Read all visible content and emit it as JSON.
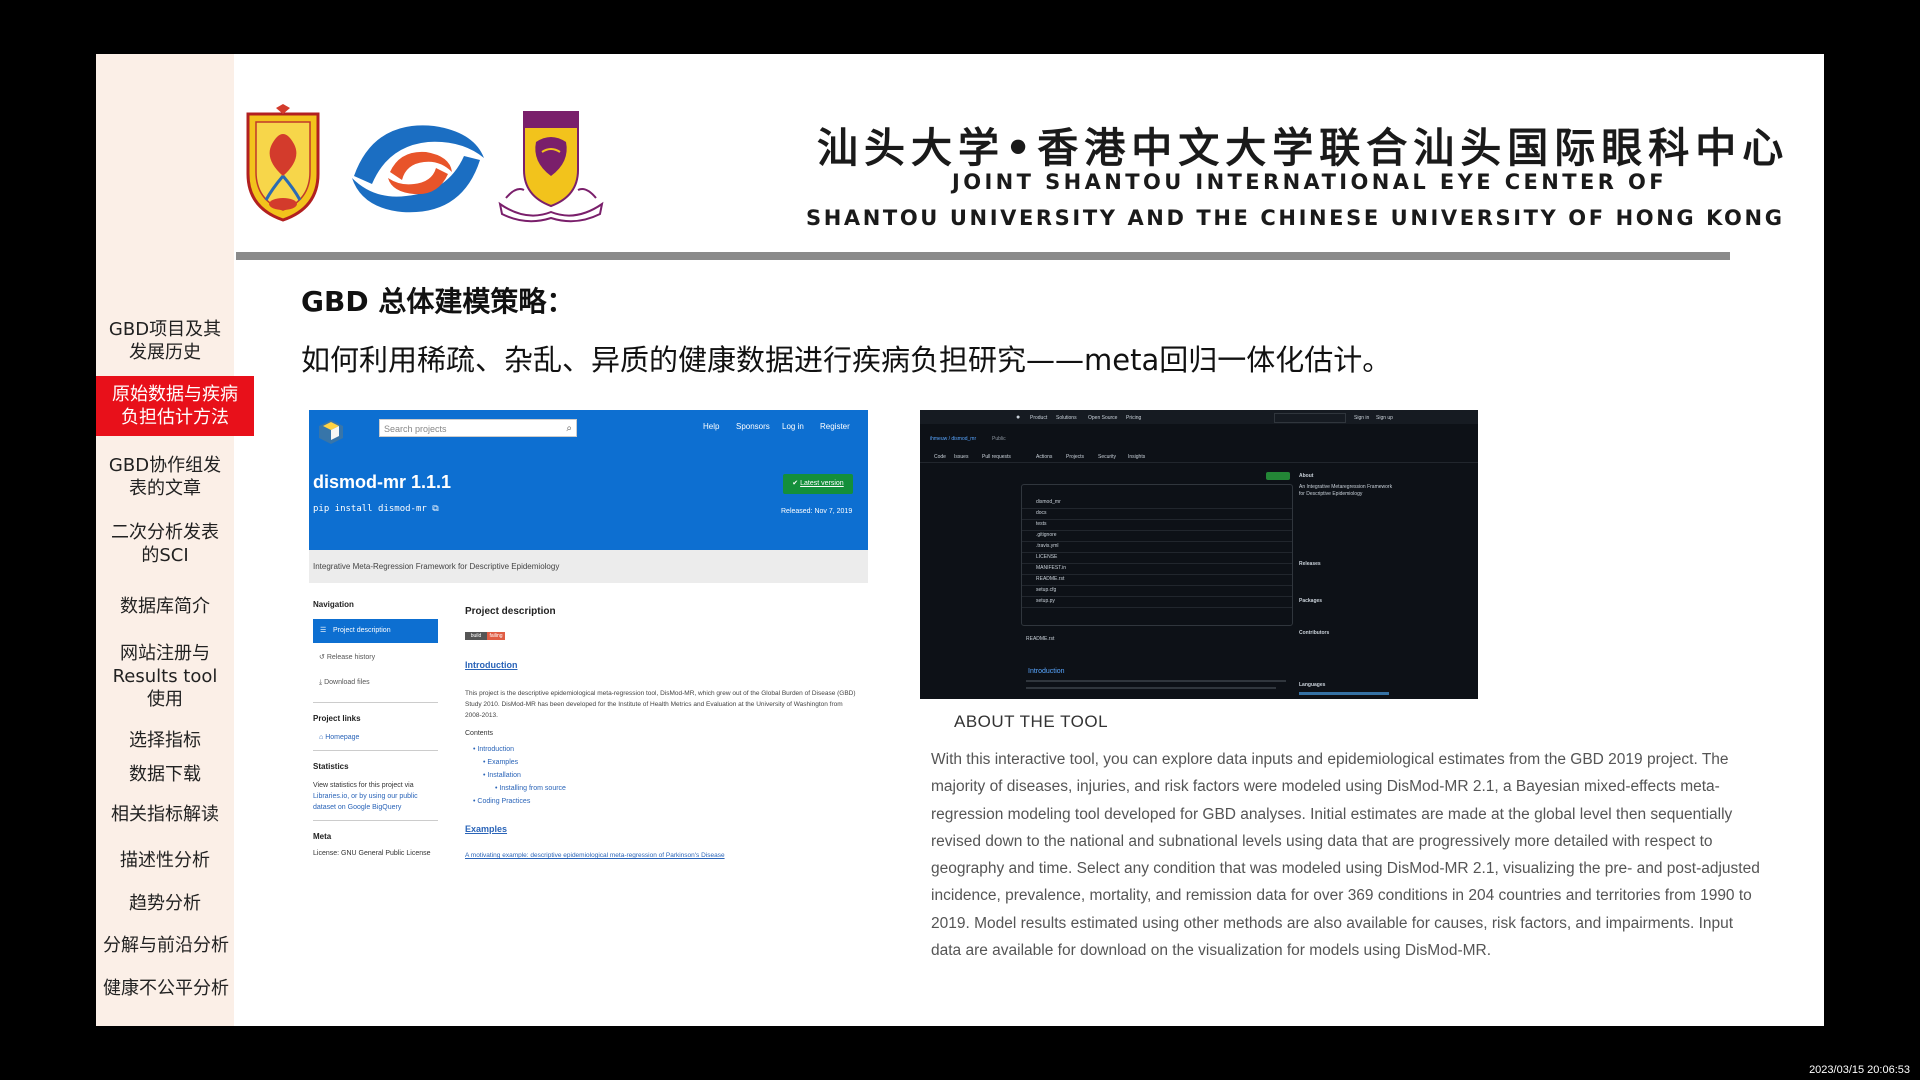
{
  "sidebar": {
    "items": [
      {
        "label": "GBD项目及其\n发展历史",
        "active": false
      },
      {
        "label": "原始数据与疾病\n负担估计方法",
        "active": true
      },
      {
        "label": "GBD协作组发\n表的文章",
        "active": false
      },
      {
        "label": "二次分析发表\n的SCI",
        "active": false
      },
      {
        "label": "数据库简介",
        "active": false
      },
      {
        "label": "网站注册与\nResults tool\n使用",
        "active": false
      },
      {
        "label": "选择指标",
        "active": false
      },
      {
        "label": "数据下载",
        "active": false
      },
      {
        "label": "相关指标解读",
        "active": false
      },
      {
        "label": "描述性分析",
        "active": false
      },
      {
        "label": "趋势分析",
        "active": false
      },
      {
        "label": "分解与前沿分析",
        "active": false
      },
      {
        "label": "健康不公平分析",
        "active": false
      }
    ],
    "active_color": "#e8101a",
    "bg_color": "#fbefe7"
  },
  "header": {
    "title_cn": "汕头大学•香港中文大学联合汕头国际眼科中心",
    "title_en_line1": "JOINT SHANTOU INTERNATIONAL EYE CENTER  OF",
    "title_en_line2": "SHANTOU UNIVERSITY AND THE CHINESE UNIVERSITY OF HONG KONG"
  },
  "content": {
    "heading": "GBD 总体建模策略：",
    "subheading": "如何利用稀疏、杂乱、异质的健康数据进行疾病负担研究——meta回归一体化估计。"
  },
  "pypi": {
    "search_placeholder": "Search projects",
    "nav": [
      "Help",
      "Sponsors",
      "Log in",
      "Register"
    ],
    "package_name": "dismod-mr 1.1.1",
    "pip_command": "pip install dismod-mr",
    "latest_label": "Latest version",
    "released": "Released: Nov 7, 2019",
    "summary": "Integrative Meta-Regression Framework for Descriptive Epidemiology",
    "navigation_title": "Navigation",
    "nav_items": [
      "Project description",
      "Release history",
      "Download files"
    ],
    "project_links_title": "Project links",
    "homepage": "Homepage",
    "statistics_title": "Statistics",
    "statistics_text_1": "View statistics for this project via",
    "statistics_text_2": "Libraries.io, or by using our public",
    "statistics_text_3": "dataset on Google BigQuery",
    "meta_title": "Meta",
    "license": "License: GNU General Public License",
    "description_title": "Project description",
    "badge_left": "build",
    "badge_right": "failing",
    "intro_title": "Introduction",
    "intro_text": "This project is the descriptive epidemiological meta-regression tool, DisMod-MR, which grew out of the Global Burden of Disease (GBD) Study 2010. DisMod-MR has been developed for the Institute of Health Metrics and Evaluation at the University of Washington from 2008-2013.",
    "contents_title": "Contents",
    "contents": [
      "Introduction",
      "Examples",
      "Installation",
      "Installing from source",
      "Coding Practices"
    ],
    "examples_title": "Examples",
    "example_link": "A motivating example: descriptive epidemiological meta-regression of Parkinson's Disease"
  },
  "github": {
    "nav": [
      "Product",
      "Solutions",
      "Open Source",
      "Pricing"
    ],
    "sign_in": "Sign in",
    "sign_up": "Sign up",
    "repo": "ihmeuw / dismod_mr",
    "visibility": "Public",
    "tabs": [
      "Code",
      "Issues",
      "Pull requests",
      "Actions",
      "Projects",
      "Security",
      "Insights"
    ],
    "files": [
      "dismod_mr",
      "docs",
      "tests",
      ".gitignore",
      ".travis.yml",
      "LICENSE",
      "MANIFEST.in",
      "README.rst",
      "setup.cfg",
      "setup.py"
    ],
    "about_title": "About",
    "about_text": "An Integrative Metaregression Framework for Descriptive Epidemiology",
    "releases": "Releases",
    "packages": "Packages",
    "contributors": "Contributors",
    "readme": "README.rst",
    "introduction": "Introduction",
    "languages": "Languages"
  },
  "about": {
    "title": "ABOUT THE TOOL",
    "text": "With this interactive tool, you can explore data inputs and epidemiological estimates from the GBD 2019 project. The majority of diseases, injuries, and risk factors were modeled using DisMod-MR 2.1, a Bayesian mixed-effects meta-regression modeling tool developed for GBD analyses. Initial estimates are made at the global level then sequentially revised down to the national and subnational levels using data that are progressively more detailed with respect to geography and time. Select any condition that was modeled using DisMod-MR 2.1, visualizing the pre- and post-adjusted incidence, prevalence, mortality, and remission data for over 369 conditions in 204 countries and territories from 1990 to 2019. Model results estimated using other methods are also available for causes, risk factors, and impairments. Input data are available for download on the visualization for models using DisMod-MR."
  },
  "timestamp": "2023/03/15 20:06:53"
}
